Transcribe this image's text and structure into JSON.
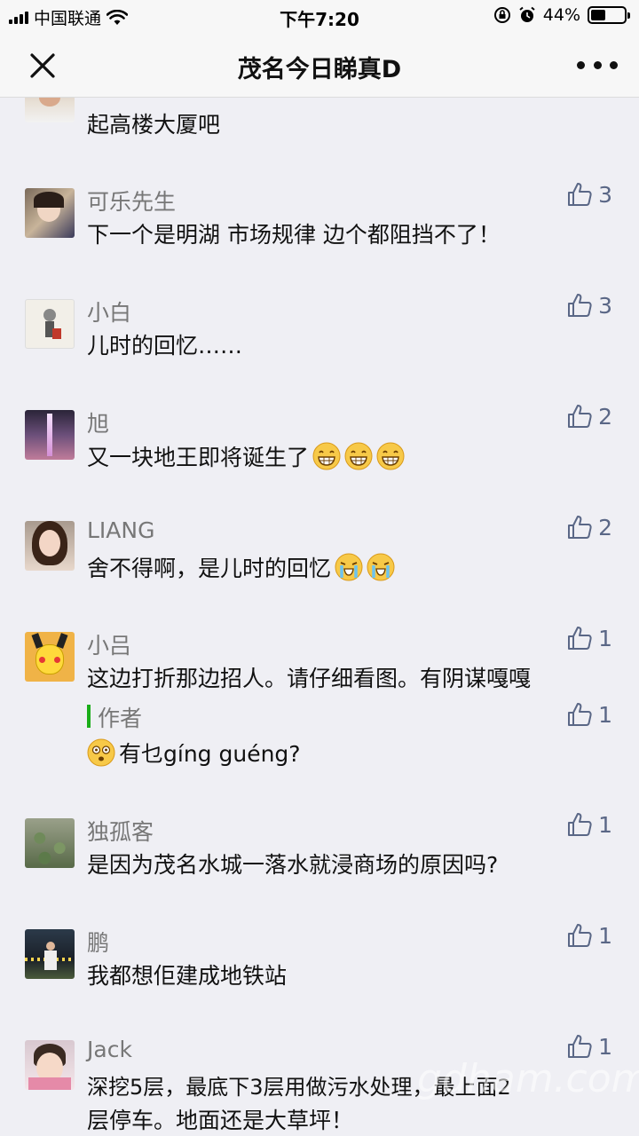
{
  "status_bar": {
    "carrier": "中国联通",
    "time": "下午7:20",
    "battery": "44%",
    "battery_level": 0.44
  },
  "nav": {
    "title": "茂名今日睇真D"
  },
  "comments": [
    {
      "name": "",
      "text": "起高楼大厦吧",
      "likes": ""
    },
    {
      "name": "可乐先生",
      "text": "下一个是明湖 市场规律 边个都阻挡不了！",
      "likes": "3"
    },
    {
      "name": "小白",
      "text": "儿时的回忆……",
      "likes": "3"
    },
    {
      "name": "旭",
      "text": "又一块地王即将诞生了",
      "likes": "2",
      "emojis": [
        "grin-emoji",
        "grin-emoji",
        "grin-emoji"
      ]
    },
    {
      "name": "LIANG",
      "text": "舍不得啊，是儿时的回忆",
      "likes": "2",
      "emojis": [
        "crying-emoji",
        "crying-emoji"
      ]
    },
    {
      "name": "小吕",
      "text": "这边打折那边招人。请仔细看图。有阴谋嘎嘎",
      "likes": "1"
    },
    {
      "name": "作者",
      "text": "有乜gíng guéng?",
      "likes": "1",
      "emojis": [
        "dizzy-emoji"
      ]
    },
    {
      "name": "独孤客",
      "text": "是因为茂名水城一落水就浸商场的原因吗?",
      "likes": "1"
    },
    {
      "name": "鹏",
      "text": "我都想佢建成地铁站",
      "likes": "1"
    },
    {
      "name": "Jack",
      "text": "深挖5层，最底下3层用做污水处理，最上面2",
      "text2": "层停车。地面还是大草坪！",
      "likes": "1"
    }
  ],
  "watermark": "gdham.com",
  "colors": {
    "like": "#5a6786",
    "author_bar": "#1aad19",
    "name": "#777777"
  }
}
